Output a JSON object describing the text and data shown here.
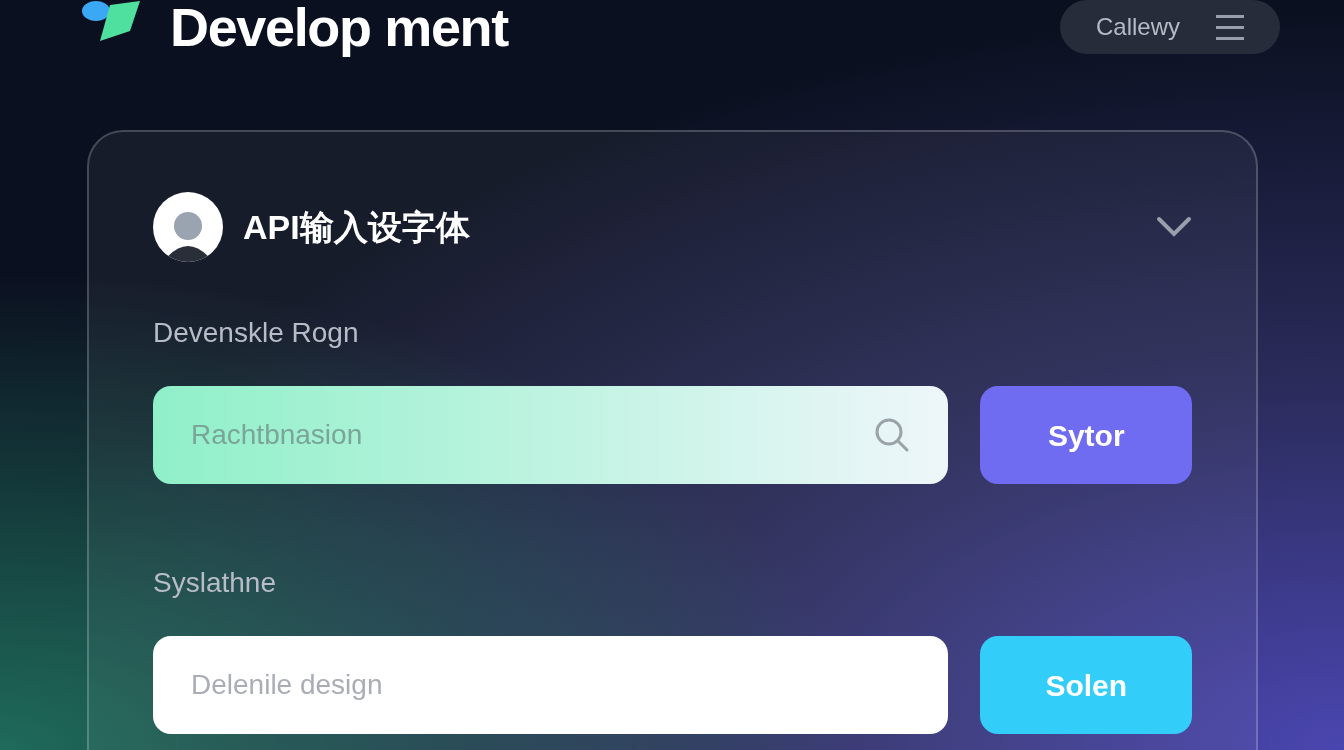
{
  "header": {
    "title": "Develop ment",
    "menu_label": "Callewy"
  },
  "card": {
    "title": "API输入设字体",
    "fields": [
      {
        "label": "Devenskle Rogn",
        "placeholder": "Rachtbnasion",
        "button": "Sytor",
        "kind": "search"
      },
      {
        "label": "Syslathne",
        "placeholder": "Delenile design",
        "button": "Solen",
        "kind": "plain"
      }
    ]
  }
}
